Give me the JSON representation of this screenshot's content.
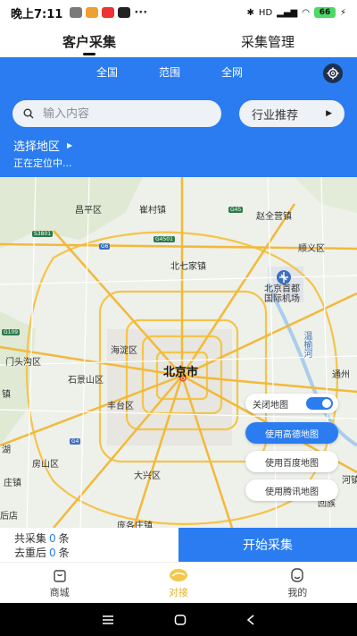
{
  "status_bar": {
    "time": "晚上7:11",
    "dots": "···",
    "battery": "66",
    "network": "HD"
  },
  "top_tabs": [
    {
      "label": "客户采集",
      "active": true
    },
    {
      "label": "采集管理",
      "active": false
    }
  ],
  "scope_tabs": [
    "全国",
    "范围",
    "全网"
  ],
  "search": {
    "placeholder": "输入内容"
  },
  "industry_button": "行业推荐",
  "region": {
    "label": "选择地区",
    "status": "正在定位中..."
  },
  "map": {
    "city": "北京市",
    "labels": {
      "changping": "昌平区",
      "cuicun": "崔村镇",
      "zhaoquanying": "赵全营镇",
      "shunyi": "顺义区",
      "beiqijia": "北七家镇",
      "airport": "北京首都\n国际机场",
      "haidian": "海淀区",
      "mentougou": "门头沟区",
      "shijingshan": "石景山区",
      "fengtai": "丰台区",
      "fangshan": "房山区",
      "daxing": "大兴区",
      "pangezhuang": "庞各庄镇",
      "tongzhou": "通州",
      "wenyu": "温榆河",
      "zhen_left": "镇",
      "hu": "湖",
      "hezhen": "河镇",
      "zhuangzhen": "庄镇",
      "houdian": "后店",
      "huizhen": "回族"
    },
    "roads": [
      "G45",
      "S3801",
      "G6",
      "G4501",
      "G109",
      "G4"
    ],
    "controls": {
      "close_map_label": "关闭地图",
      "close_map_on": true,
      "amap": "使用高德地图",
      "baidu": "使用百度地图",
      "tencent": "使用腾讯地图"
    }
  },
  "stats": {
    "total_label": "共采集",
    "total_value": "0",
    "dedup_label": "去重后",
    "dedup_value": "0",
    "unit": "条"
  },
  "start_button": "开始采集",
  "bottom_nav": [
    {
      "label": "商城",
      "icon": "shop-bag-icon",
      "active": false
    },
    {
      "label": "对接",
      "icon": "handshake-icon",
      "active": true
    },
    {
      "label": "我的",
      "icon": "profile-icon",
      "active": false
    }
  ],
  "colors": {
    "accent": "#2a7cf0",
    "nav_active": "#e0b030"
  }
}
